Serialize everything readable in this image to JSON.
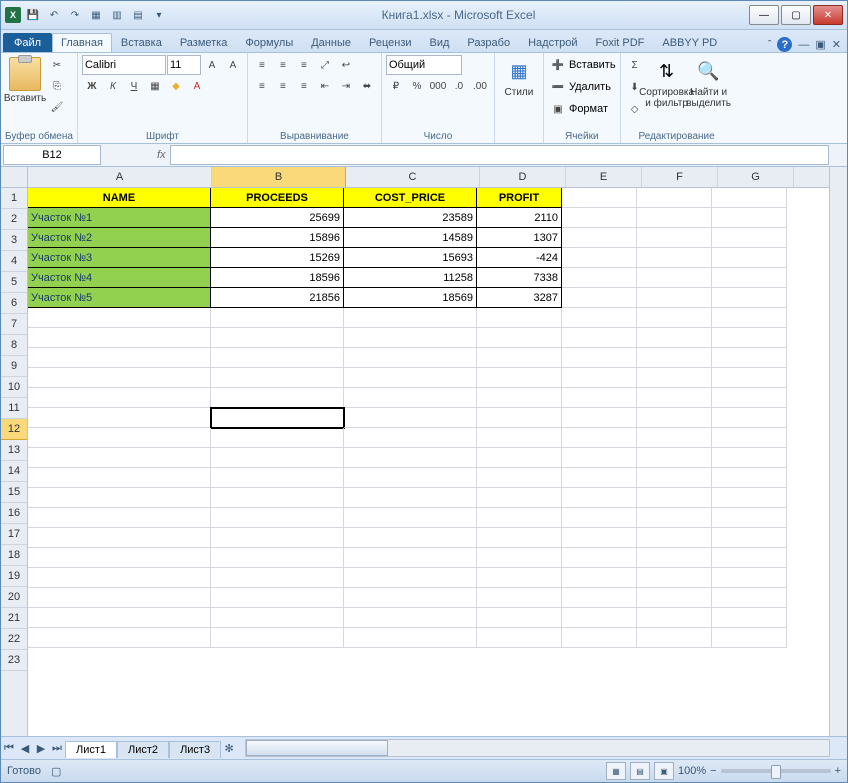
{
  "title": "Книга1.xlsx - Microsoft Excel",
  "qat": {
    "excel": "X"
  },
  "tabs": {
    "file": "Файл",
    "home": "Главная",
    "insert": "Вставка",
    "layout": "Разметка",
    "formulas": "Формулы",
    "data": "Данные",
    "review": "Рецензи",
    "view": "Вид",
    "dev": "Разрабо",
    "addins": "Надстрой",
    "foxit": "Foxit PDF",
    "abbyy": "ABBYY PD"
  },
  "ribbon": {
    "clipboard": {
      "paste": "Вставить",
      "label": "Буфер обмена"
    },
    "font": {
      "name": "Calibri",
      "size": "11",
      "label": "Шрифт",
      "bold": "Ж",
      "italic": "К",
      "underline": "Ч"
    },
    "align": {
      "label": "Выравнивание"
    },
    "number": {
      "format": "Общий",
      "label": "Число"
    },
    "styles": {
      "btn": "Стили"
    },
    "cells": {
      "insert": "Вставить",
      "delete": "Удалить",
      "format": "Формат",
      "label": "Ячейки"
    },
    "editing": {
      "sort": "Сортировка и фильтр",
      "find": "Найти и выделить",
      "label": "Редактирование"
    }
  },
  "namebox": "B12",
  "fx": "fx",
  "columns": [
    "A",
    "B",
    "C",
    "D",
    "E",
    "F",
    "G"
  ],
  "rows": [
    "1",
    "2",
    "3",
    "4",
    "5",
    "6",
    "7",
    "8",
    "9",
    "10",
    "11",
    "12",
    "13",
    "14",
    "15",
    "16",
    "17",
    "18",
    "19",
    "20",
    "21",
    "22",
    "23"
  ],
  "headers": {
    "a": "NAME",
    "b": "PROCEEDS",
    "c": "COST_PRICE",
    "d": "PROFIT"
  },
  "data": [
    {
      "name": "Участок №1",
      "b": "25699",
      "c": "23589",
      "d": "2110"
    },
    {
      "name": "Участок №2",
      "b": "15896",
      "c": "14589",
      "d": "1307"
    },
    {
      "name": "Участок №3",
      "b": "15269",
      "c": "15693",
      "d": "-424"
    },
    {
      "name": "Участок №4",
      "b": "18596",
      "c": "11258",
      "d": "7338"
    },
    {
      "name": "Участок №5",
      "b": "21856",
      "c": "18569",
      "d": "3287"
    }
  ],
  "sheets": {
    "s1": "Лист1",
    "s2": "Лист2",
    "s3": "Лист3"
  },
  "status": {
    "ready": "Готово",
    "zoom": "100%"
  }
}
